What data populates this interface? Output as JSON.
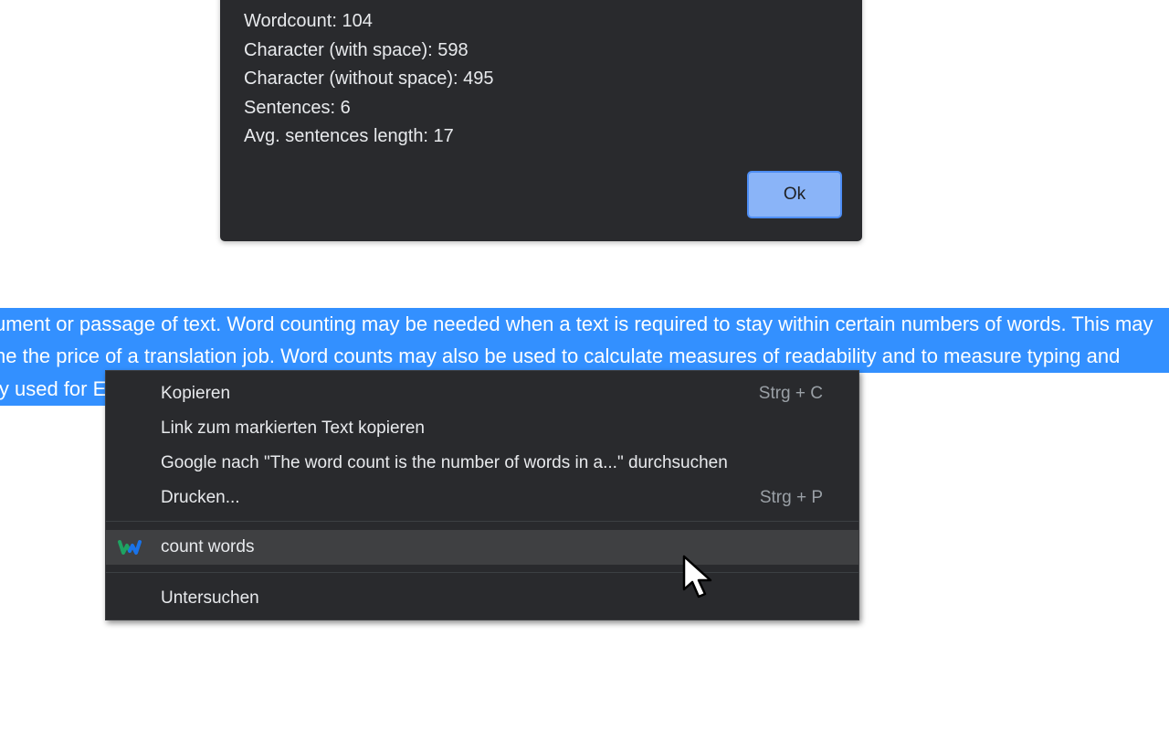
{
  "dialog": {
    "lines": [
      "Wordcount: 104",
      "Character (with space): 598",
      "Character (without space): 495",
      "Sentences: 6",
      "Avg. sentences length: 17"
    ],
    "ok_label": "Ok"
  },
  "selected_text": {
    "lines": [
      "ument or passage of text. Word counting may be needed when a text is required to stay within certain numbers of words. This may",
      "ne the price of a translation job. Word counts may also be used to calculate measures of readability and to measure typing and",
      "ly used for E"
    ],
    "highlight_color": "#3390ff"
  },
  "context_menu": {
    "items": [
      {
        "label": "Kopieren",
        "shortcut": "Strg + C"
      },
      {
        "label": "Link zum markierten Text kopieren",
        "shortcut": ""
      },
      {
        "label": "Google nach \"The word count is the number of words in a...\" durchsuchen",
        "shortcut": ""
      },
      {
        "label": "Drucken...",
        "shortcut": "Strg + P"
      },
      {
        "label": "count words",
        "shortcut": "",
        "icon": "word-counter-extension-icon",
        "highlighted": true
      },
      {
        "label": "Untersuchen",
        "shortcut": ""
      }
    ]
  },
  "colors": {
    "dialog_bg": "#292a2d",
    "ok_button": "#8ab4f8",
    "menu_bg": "#292a2d",
    "menu_highlight": "#3f4042",
    "extension_icon_green": "#1ea362",
    "extension_icon_blue": "#1a73e8"
  }
}
